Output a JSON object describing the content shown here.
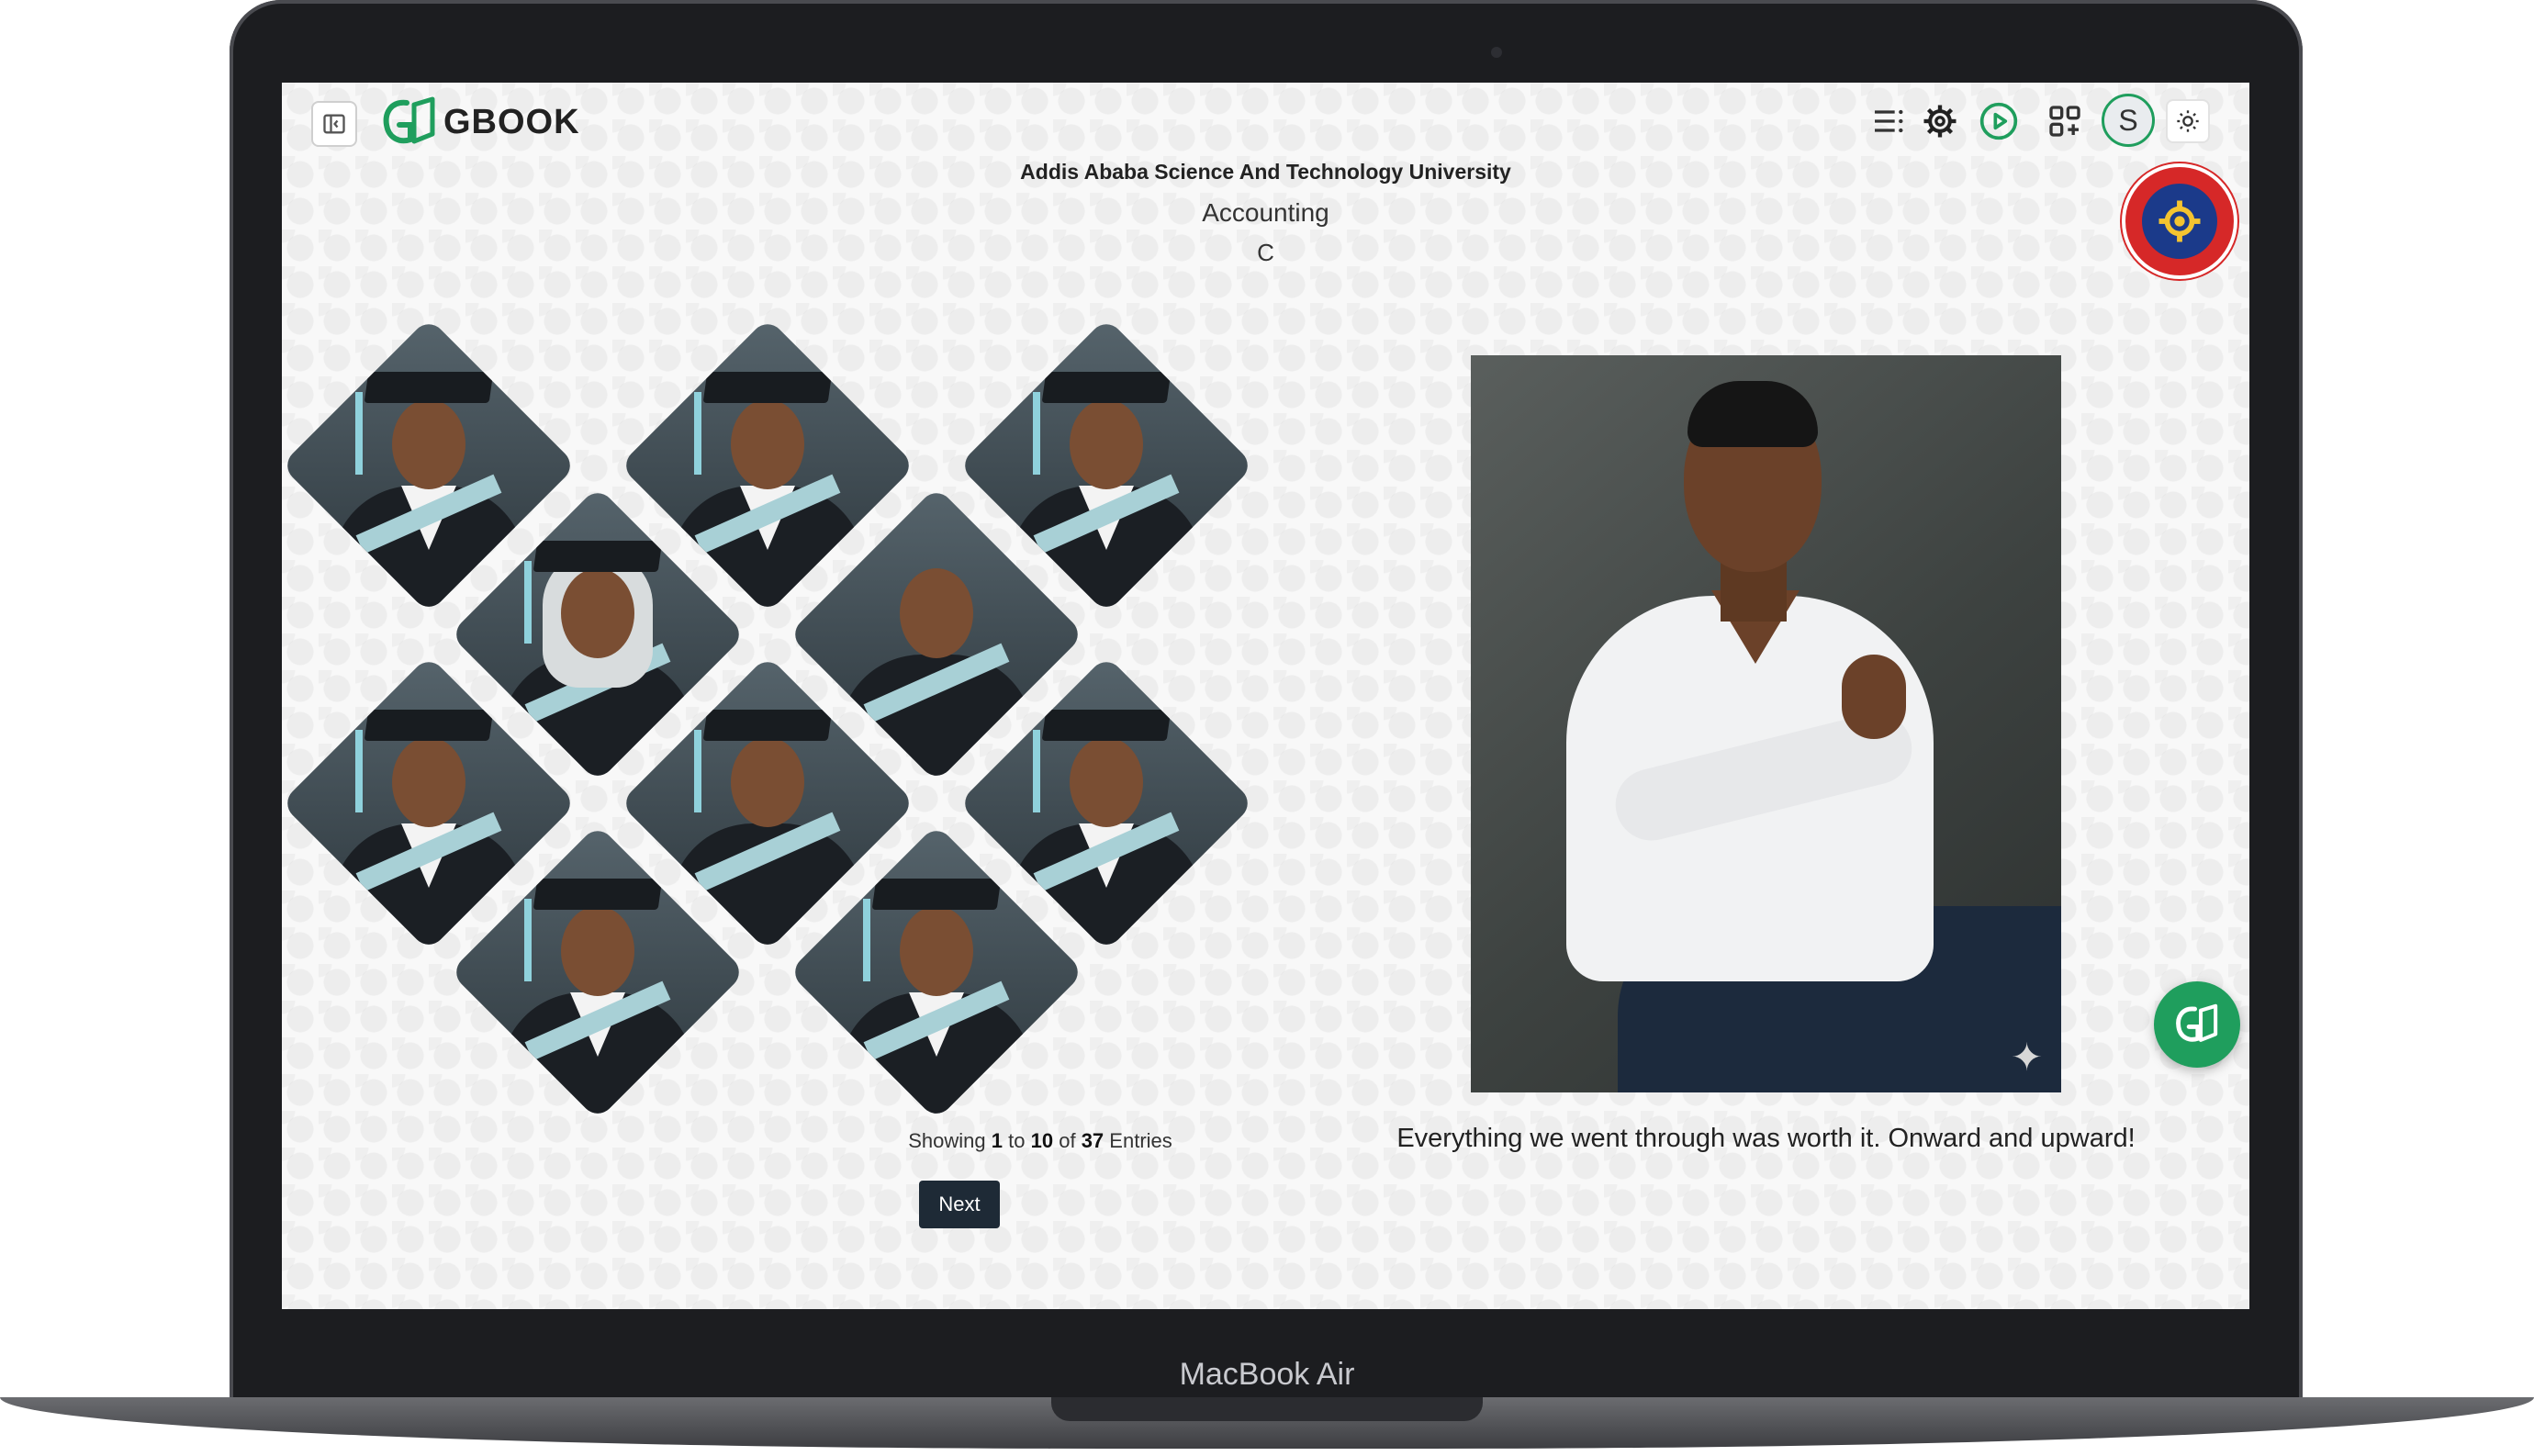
{
  "device": {
    "model_label": "MacBook Air"
  },
  "header": {
    "logo_text": "GBOOK",
    "icons": [
      "sidebar-toggle-icon",
      "menu-icon",
      "settings-gear-icon",
      "play-icon",
      "apps-grid-icon",
      "sun-icon"
    ],
    "avatar_initial": "S"
  },
  "page": {
    "university": "Addis Ababa Science And Technology University",
    "department": "Accounting",
    "section": "C"
  },
  "pagination": {
    "prefix": "Showing",
    "from": "1",
    "to_word": "to",
    "to": "10",
    "of_word": "of",
    "total": "37",
    "suffix": "Entries",
    "next_label": "Next"
  },
  "featured": {
    "quote": "Everything we went through was worth it. Onward and upward!"
  },
  "colors": {
    "accent": "#1f9e5d",
    "button_dark": "#1e2a36",
    "seal_red": "#d62828"
  }
}
